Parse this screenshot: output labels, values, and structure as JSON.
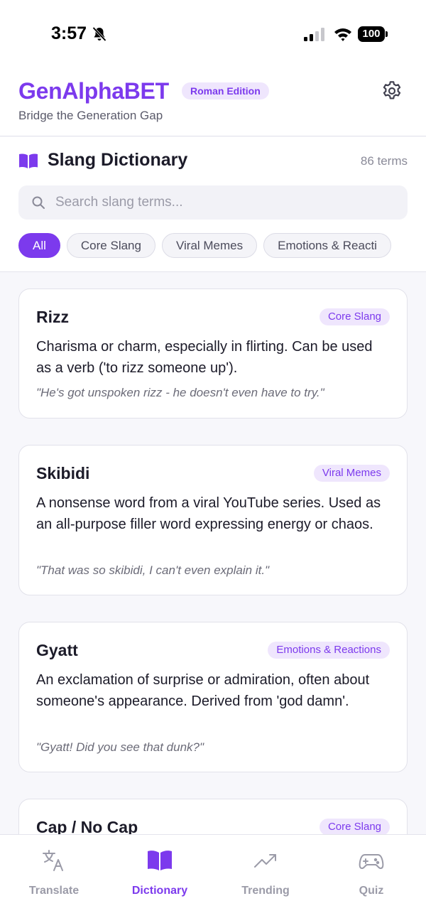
{
  "status_bar": {
    "time": "3:57",
    "battery": "100"
  },
  "header": {
    "title": "GenAlphaBET",
    "badge": "Roman Edition",
    "subtitle": "Bridge the Generation Gap"
  },
  "dictionary": {
    "title": "Slang Dictionary",
    "count": "86 terms",
    "search_placeholder": "Search slang terms...",
    "filters": [
      "All",
      "Core Slang",
      "Viral Memes",
      "Emotions & Reacti"
    ]
  },
  "terms": [
    {
      "term": "Rizz",
      "tag": "Core Slang",
      "definition": "Charisma or charm, especially in flirting. Can be used as a verb ('to rizz someone up').",
      "example": "\"He's got unspoken rizz - he doesn't even have to try.\""
    },
    {
      "term": "Skibidi",
      "tag": "Viral Memes",
      "definition": "A nonsense word from a viral YouTube series. Used as an all-purpose filler word expressing energy or chaos.",
      "example": "\"That was so skibidi, I can't even explain it.\""
    },
    {
      "term": "Gyatt",
      "tag": "Emotions & Reactions",
      "definition": "An exclamation of surprise or admiration, often about someone's appearance. Derived from 'god damn'.",
      "example": "\"Gyatt! Did you see that dunk?\""
    },
    {
      "term": "Cap / No Cap",
      "tag": "Core Slang",
      "definition": "",
      "example": ""
    }
  ],
  "nav": {
    "translate": "Translate",
    "dictionary": "Dictionary",
    "trending": "Trending",
    "quiz": "Quiz"
  },
  "colors": {
    "accent": "#7c3aed",
    "accent_soft": "#efe6fd",
    "inactive": "#9b9ba8"
  }
}
